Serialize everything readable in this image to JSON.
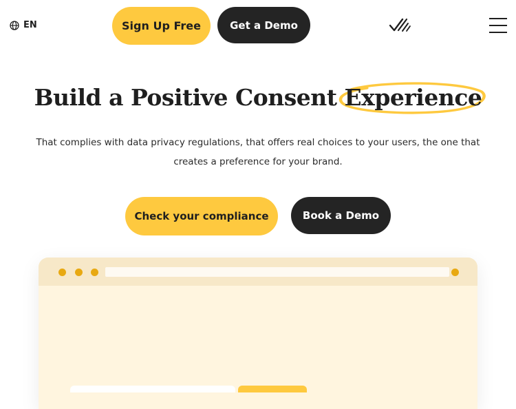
{
  "header": {
    "language": "EN",
    "signup_label": "Sign Up Free",
    "demo_label": "Get a Demo",
    "globe_icon": "globe-icon",
    "logo_icon": "brand-check-logo-icon",
    "menu_icon": "hamburger-menu-icon"
  },
  "hero": {
    "title_before": "Build a Positive Consent ",
    "title_highlight": "Experience",
    "subtitle": "That complies with data privacy regulations, that offers real choices to your users, the one that creates a preference for your brand.",
    "primary_cta": "Check your compliance",
    "secondary_cta": "Book a Demo"
  },
  "colors": {
    "accent_yellow": "#fec93f",
    "dark": "#242424",
    "browser_bg": "#fff5df",
    "browser_bar": "#f7e8c8",
    "browser_dot": "#e8a912"
  }
}
